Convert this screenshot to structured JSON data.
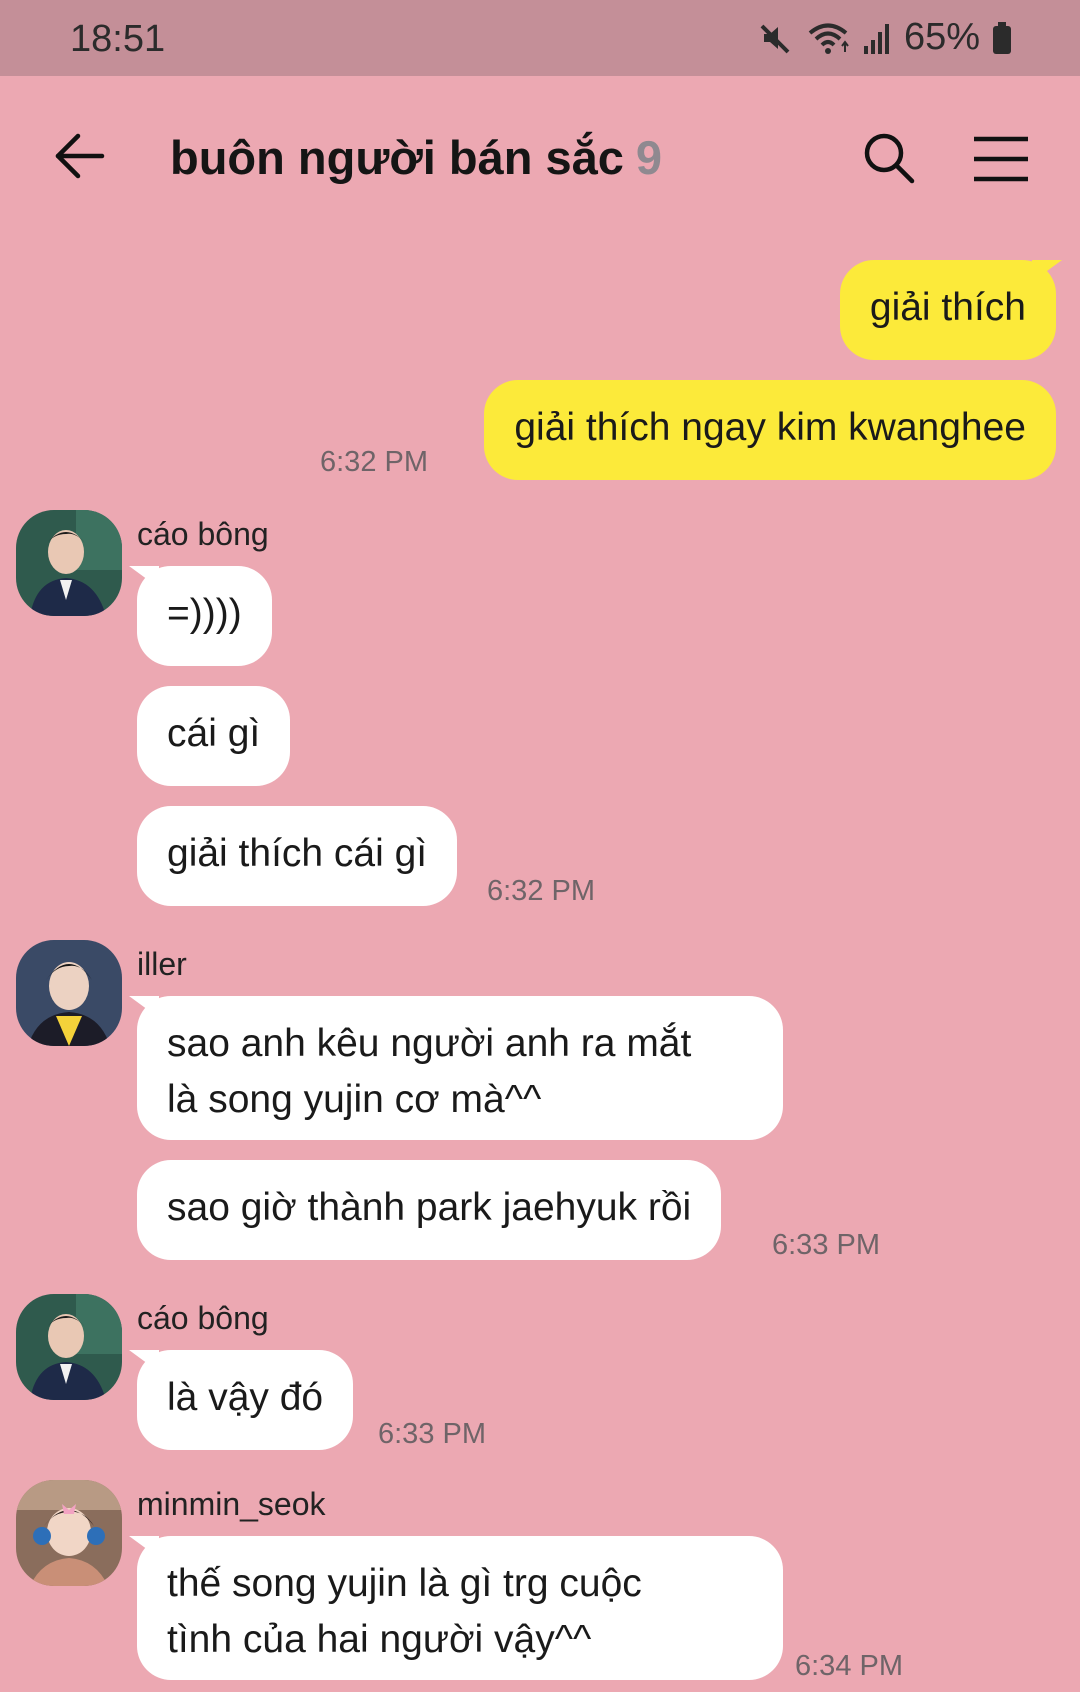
{
  "status_bar": {
    "time": "18:51",
    "battery_percent": "65%",
    "icons": [
      "mute-icon",
      "wifi-icon",
      "signal-icon",
      "battery-icon"
    ]
  },
  "header": {
    "title": "buôn người bán sắc",
    "member_count": "9",
    "icons": [
      "back-arrow-icon",
      "search-icon",
      "menu-icon"
    ]
  },
  "messages": [
    {
      "direction": "out",
      "text": "giải thích"
    },
    {
      "direction": "out",
      "text": "giải thích ngay kim kwanghee",
      "time": "6:32 PM"
    },
    {
      "direction": "in",
      "sender": "cáo bông",
      "text": "=))))"
    },
    {
      "direction": "in",
      "text": "cái gì"
    },
    {
      "direction": "in",
      "text": "giải thích cái gì",
      "time": "6:32 PM"
    },
    {
      "direction": "in",
      "sender": "iller",
      "lines": [
        "sao anh kêu người anh ra mắt",
        "là song yujin cơ mà^^"
      ]
    },
    {
      "direction": "in",
      "text": "sao giờ thành park jaehyuk rồi",
      "time": "6:33 PM"
    },
    {
      "direction": "in",
      "sender": "cáo bông",
      "text": "là vậy đó",
      "time": "6:33 PM"
    },
    {
      "direction": "in",
      "sender": "minmin_seok",
      "lines": [
        "thế song yujin là gì trg cuộc",
        "tình của hai người vậy^^"
      ],
      "time": "6:34 PM"
    }
  ]
}
